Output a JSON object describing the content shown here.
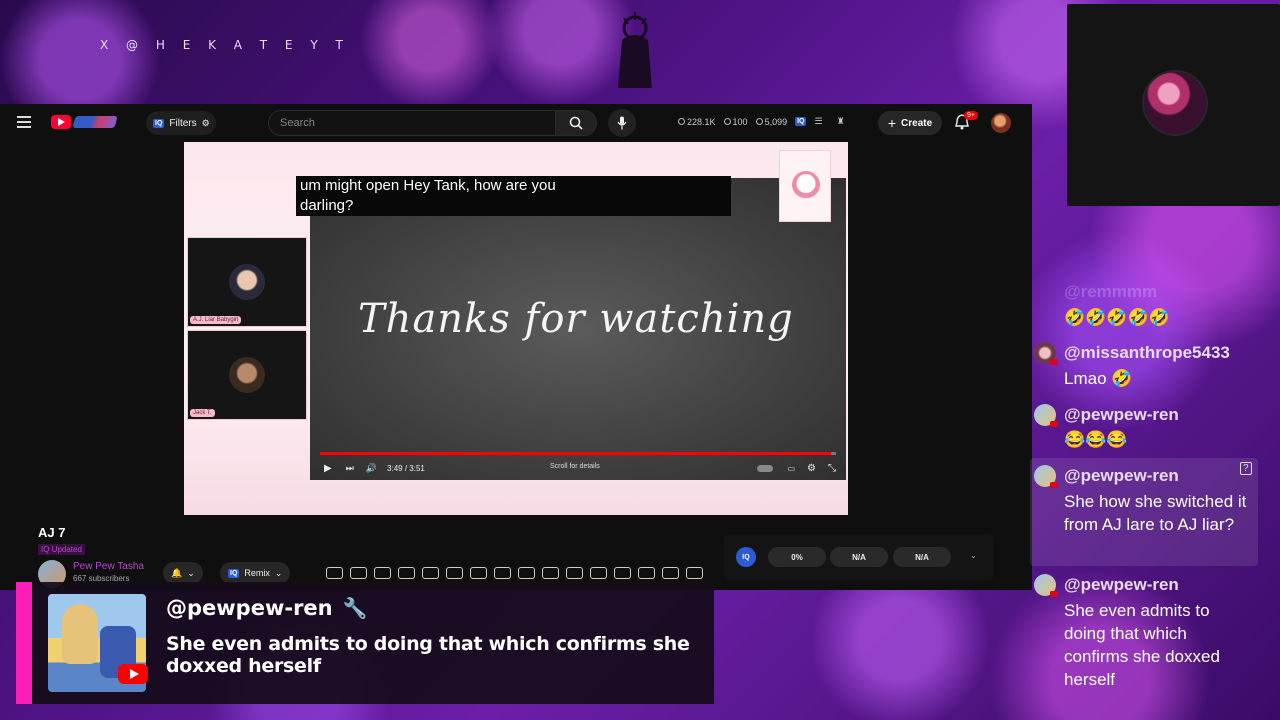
{
  "overlay": {
    "handle": "X @ H E K A T E Y T"
  },
  "youtube": {
    "search_placeholder": "Search",
    "filters_label": "Filters",
    "iq_label": "IQ",
    "stats": {
      "views": "228.1K",
      "viewers": "100",
      "likes": "5,099"
    },
    "create_label": "Create",
    "notifications_badge": "9+"
  },
  "video": {
    "caption_line1": "um might open Hey Tank, how are you",
    "caption_line2": "darling?",
    "title_card": "Thanks for watching",
    "time": "3:49 / 3:51",
    "progress": 0.99,
    "scroll_hint": "Scroll for details",
    "participants": [
      {
        "name": "A.J. Liar Babygirl"
      },
      {
        "name": "Jack T."
      }
    ]
  },
  "below_video": {
    "title": "AJ 7",
    "tag": "IQ Updated",
    "channel_name": "Pew Pew Tasha",
    "subscribers": "667 subscribers",
    "remix_label": "Remix",
    "iq_stats": [
      "0%",
      "N/A",
      "N/A"
    ]
  },
  "featured_message": {
    "user": "@pewpew-ren",
    "text": "She even admits to doing that which confirms she doxxed herself"
  },
  "chat": [
    {
      "user": "@remmmm",
      "text": "🤣🤣🤣🤣🤣"
    },
    {
      "user": "@missanthrope5433",
      "text": "Lmao 🤣"
    },
    {
      "user": "@pewpew-ren",
      "text": "😂😂😂"
    },
    {
      "user": "@pewpew-ren",
      "text": "She how she switched it from AJ lare to AJ liar?"
    },
    {
      "user": "@pewpew-ren",
      "text": "She even admits to doing that which confirms she doxxed herself"
    }
  ],
  "colors": {
    "accent_pink": "#ff1fb8",
    "youtube_red": "#ff0000",
    "iq_blue": "#2d5bd6"
  }
}
